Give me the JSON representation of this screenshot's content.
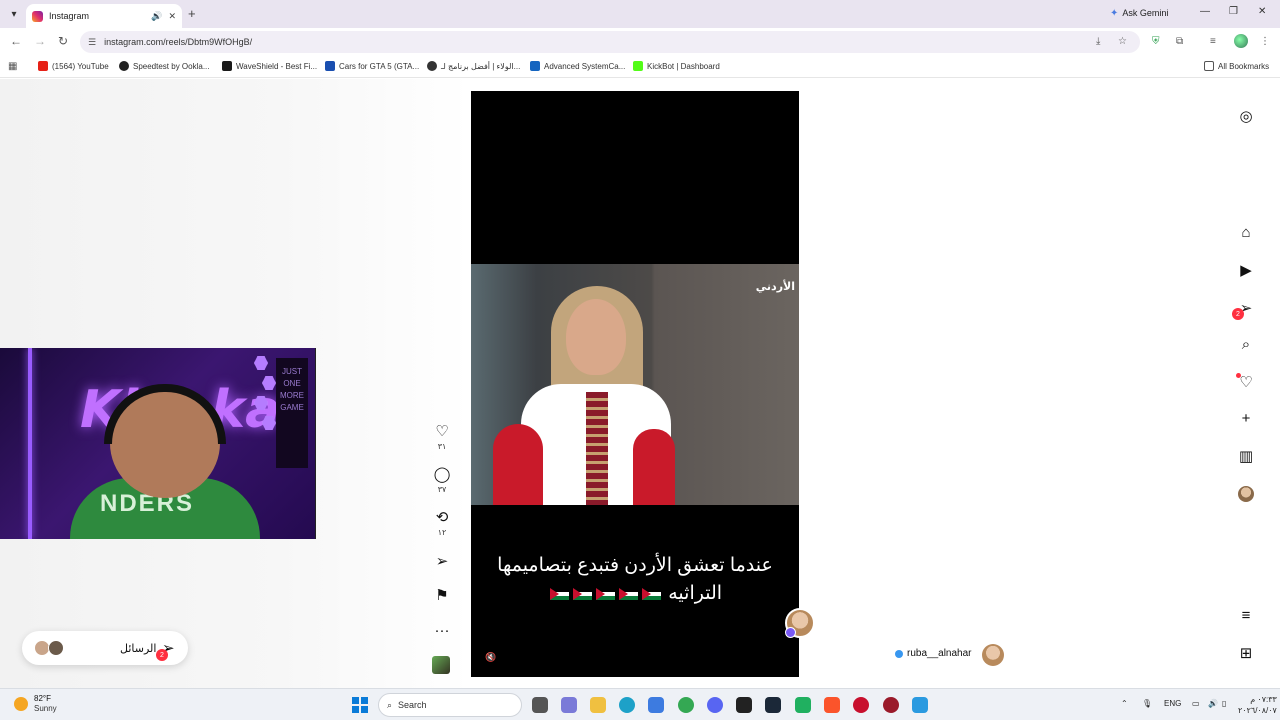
{
  "tab": {
    "title": "Instagram"
  },
  "gemini": {
    "label": "Ask Gemini"
  },
  "address": {
    "url": "instagram.com/reels/Dbtm9WfOHgB/"
  },
  "bookmarks": [
    {
      "label": "(1564) YouTube",
      "color": "#e62117"
    },
    {
      "label": "Speedtest by Ookla...",
      "color": "#222222"
    },
    {
      "label": "WaveShield - Best Fi...",
      "color": "#1a1a1a"
    },
    {
      "label": "Cars for GTA 5 (GTA...",
      "color": "#1a4fb0"
    },
    {
      "label": "الولاء | أفضل برنامج لـ...",
      "color": "#333333"
    },
    {
      "label": "Advanced SystemCa...",
      "color": "#1565c0"
    },
    {
      "label": "KickBot | Dashboard",
      "color": "#53fc18"
    }
  ],
  "all_bookmarks": "All Bookmarks",
  "reel": {
    "channel_logo": "الأردني",
    "caption_line1": "عندما تعشق الأردن فتبدع بتصاميمها",
    "caption_line2": "التراثيه"
  },
  "actions": {
    "likes": "٣١",
    "comments": "٣٧",
    "reposts": "١٢"
  },
  "author": {
    "username": "ruba__alnahar"
  },
  "sidebar": {
    "messages_badge": "2"
  },
  "messages": {
    "label": "الرسائل",
    "badge": "2"
  },
  "webcam": {
    "overlay_text": "Kha   ka",
    "shirt_text": "NDERS",
    "poster_text": "JUST ONE MORE GAME"
  },
  "taskbar": {
    "temp": "82°F",
    "condition": "Sunny",
    "search_placeholder": "Search",
    "lang": "ENG",
    "time": "٠٧:٣٣ م",
    "date": "٢٠٢٦/٠٨/٠٧"
  }
}
